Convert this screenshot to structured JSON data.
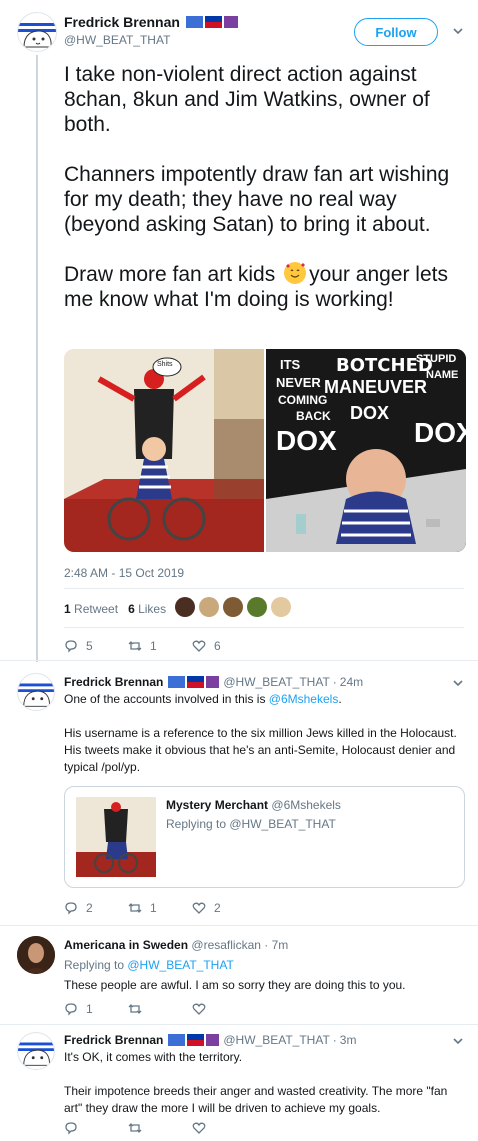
{
  "main_tweet": {
    "name": "Fredrick Brennan",
    "handle": "@HW_BEAT_THAT",
    "follow_label": "Follow",
    "paragraphs": [
      "I take non-violent direct action against 8chan, 8kun and Jim Watkins, owner of both.",
      "Channers impotently draw fan art wishing for my death; they have no real way (beyond asking Satan) to bring it about.",
      "Draw more fan art kids"
    ],
    "emoji_tail": "your anger lets me know what I'm doing is working!",
    "image_left_bubble": "Shits",
    "image_right_words": [
      "BOTCHED",
      "STUPID",
      "NAME",
      "ITS",
      "NEVER",
      "COMING",
      "BACK",
      "MANEUVER",
      "DOX",
      "DOX",
      "DOX"
    ],
    "timestamp": "2:48 AM - 15 Oct 2019",
    "retweets_count": "1",
    "retweets_label": "Retweet",
    "likes_count": "6",
    "likes_label": "Likes",
    "reply_count": "5",
    "retweet_action_count": "1",
    "like_action_count": "6"
  },
  "replies": [
    {
      "name": "Fredrick Brennan",
      "handle": "@HW_BEAT_THAT",
      "time": "24m",
      "line1_text": "One of the accounts involved in this is ",
      "line1_link": "@6Mshekels",
      "line1_end": ".",
      "para2": "His username is a reference to the six million Jews killed in the Holocaust. His tweets make it obvious that he's an anti-Semite, Holocaust denier and typical /pol/yp.",
      "quote": {
        "name": "Mystery Merchant",
        "handle": "@6Mshekels",
        "replying": "Replying to @HW_BEAT_THAT"
      },
      "reply_count": "2",
      "retweet_count": "1",
      "like_count": "2"
    },
    {
      "name": "Americana in Sweden",
      "handle": "@resaflickan",
      "time": "7m",
      "replying_prefix": "Replying to ",
      "replying_handle": "@HW_BEAT_THAT",
      "text": "These people are awful. I am so sorry they are doing this to you.",
      "reply_count": "1"
    },
    {
      "name": "Fredrick Brennan",
      "handle": "@HW_BEAT_THAT",
      "time": "3m",
      "line1": "It's OK, it comes with the territory.",
      "para2": "Their impotence breeds their anger and wasted creativity. The more \"fan art\" they draw the more I will be driven to achieve my goals."
    }
  ],
  "colors": {
    "accent": "#1da1f2",
    "text": "#14171a",
    "secondary": "#657786",
    "divider": "#e6ecf0"
  }
}
